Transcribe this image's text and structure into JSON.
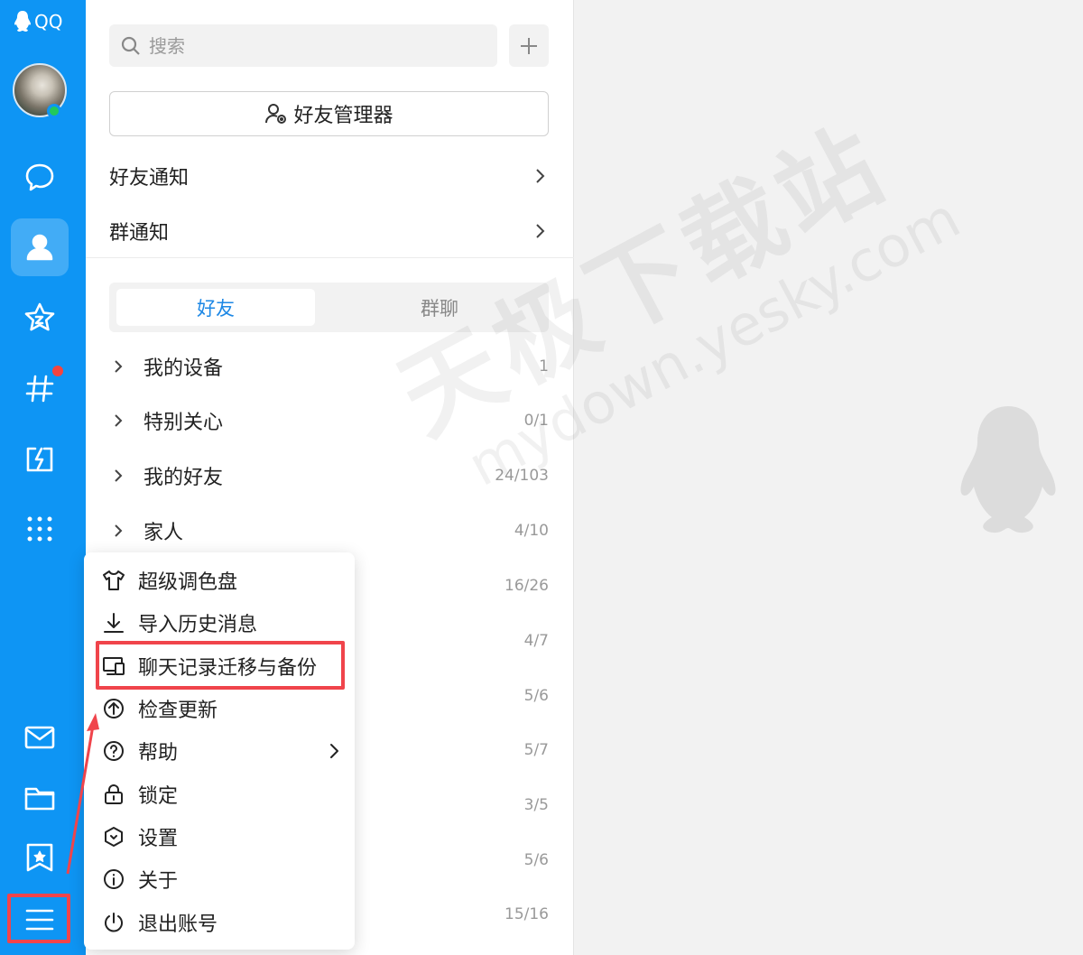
{
  "app": {
    "brand": "QQ"
  },
  "colors": {
    "rail": "#0e95f4",
    "accent": "#1e88e5",
    "highlight": "#f0444b",
    "status_online": "#22c95b",
    "badge": "#f5443f"
  },
  "rail": {
    "items": [
      {
        "name": "chat",
        "icon": "message-bubble-icon"
      },
      {
        "name": "contacts",
        "icon": "person-icon",
        "active": true
      },
      {
        "name": "favorites",
        "icon": "star-icon"
      },
      {
        "name": "channels",
        "icon": "hashtag-icon",
        "badge": true
      },
      {
        "name": "games",
        "icon": "lightning-icon"
      },
      {
        "name": "apps",
        "icon": "grid-dots-icon"
      },
      {
        "name": "mail",
        "icon": "mail-icon"
      },
      {
        "name": "files",
        "icon": "folder-icon"
      },
      {
        "name": "collection",
        "icon": "bookmark-star-icon"
      },
      {
        "name": "main-menu",
        "icon": "hamburger-menu-icon"
      }
    ]
  },
  "search": {
    "placeholder": "搜索"
  },
  "friend_manager": {
    "label": "好友管理器"
  },
  "notices": [
    {
      "label": "好友通知"
    },
    {
      "label": "群通知"
    }
  ],
  "tabs": [
    {
      "label": "好友",
      "active": true
    },
    {
      "label": "群聊",
      "active": false
    }
  ],
  "groups": [
    {
      "name": "我的设备",
      "count": "1"
    },
    {
      "name": "特别关心",
      "count": "0/1"
    },
    {
      "name": "我的好友",
      "count": "24/103"
    },
    {
      "name": "家人",
      "count": "4/10"
    }
  ],
  "hidden_counts": [
    "16/26",
    "4/7",
    "5/6",
    "5/7",
    "3/5",
    "5/6",
    "15/16"
  ],
  "menu": {
    "items": [
      {
        "label": "超级调色盘",
        "icon": "shirt-icon"
      },
      {
        "label": "导入历史消息",
        "icon": "download-icon"
      },
      {
        "label": "聊天记录迁移与备份",
        "icon": "devices-icon",
        "highlighted": true
      },
      {
        "label": "检查更新",
        "icon": "upload-circle-icon"
      },
      {
        "label": "帮助",
        "icon": "help-circle-icon",
        "submenu": true
      },
      {
        "label": "锁定",
        "icon": "lock-icon"
      },
      {
        "label": "设置",
        "icon": "hexagon-settings-icon"
      },
      {
        "label": "关于",
        "icon": "info-circle-icon"
      },
      {
        "label": "退出账号",
        "icon": "power-icon"
      }
    ]
  },
  "watermark": {
    "text_cn": "天极下载站",
    "text_url": "mydown.yesky.com"
  }
}
